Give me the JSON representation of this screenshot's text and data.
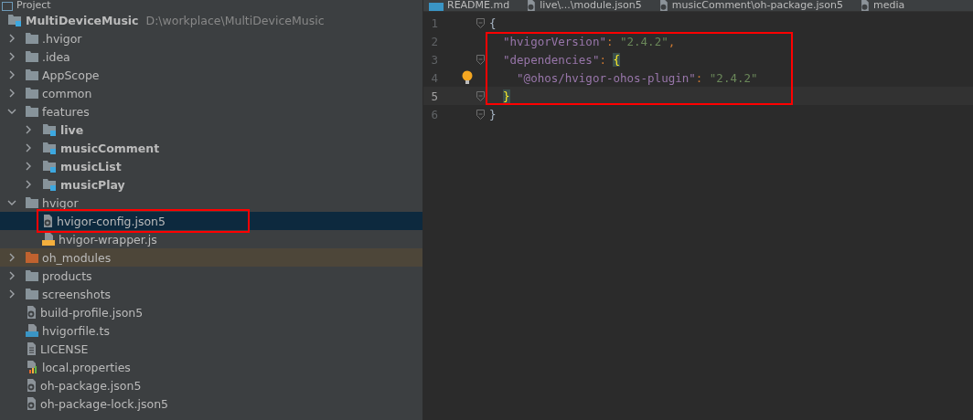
{
  "project_panel": {
    "title": "Project",
    "root": {
      "name": "MultiDeviceMusic",
      "path": "D:\\workplace\\MultiDeviceMusic"
    },
    "items": [
      {
        "name": ".hvigor",
        "kind": "folder",
        "expanded": false,
        "selected": false,
        "annotated": false
      },
      {
        "name": ".idea",
        "kind": "folder",
        "expanded": false,
        "selected": false,
        "annotated": false
      },
      {
        "name": "AppScope",
        "kind": "folder",
        "expanded": false,
        "selected": false,
        "annotated": false
      },
      {
        "name": "common",
        "kind": "folder",
        "expanded": false,
        "selected": false,
        "annotated": false
      },
      {
        "name": "features",
        "kind": "folder",
        "expanded": true,
        "selected": false,
        "annotated": false,
        "children": [
          {
            "name": "live",
            "kind": "module",
            "expanded": false,
            "selected": false,
            "annotated": false
          },
          {
            "name": "musicComment",
            "kind": "module",
            "expanded": false,
            "selected": false,
            "annotated": false
          },
          {
            "name": "musicList",
            "kind": "module",
            "expanded": false,
            "selected": false,
            "annotated": false
          },
          {
            "name": "musicPlay",
            "kind": "module",
            "expanded": false,
            "selected": false,
            "annotated": false
          }
        ]
      },
      {
        "name": "hvigor",
        "kind": "folder",
        "expanded": true,
        "selected": false,
        "annotated": false,
        "children": [
          {
            "name": "hvigor-config.json5",
            "kind": "json",
            "selected": true,
            "annotated": true
          },
          {
            "name": "hvigor-wrapper.js",
            "kind": "js",
            "selected": false,
            "annotated": false
          }
        ]
      },
      {
        "name": "oh_modules",
        "kind": "excluded",
        "expanded": false,
        "selected": false,
        "annotated": false
      },
      {
        "name": "products",
        "kind": "folder",
        "expanded": false,
        "selected": false,
        "annotated": false
      },
      {
        "name": "screenshots",
        "kind": "folder",
        "expanded": false,
        "selected": false,
        "annotated": false
      },
      {
        "name": "build-profile.json5",
        "kind": "json",
        "selected": false,
        "annotated": false
      },
      {
        "name": "hvigorfile.ts",
        "kind": "ts",
        "selected": false,
        "annotated": false
      },
      {
        "name": "LICENSE",
        "kind": "text",
        "selected": false,
        "annotated": false
      },
      {
        "name": "local.properties",
        "kind": "properties",
        "selected": false,
        "annotated": false
      },
      {
        "name": "oh-package.json5",
        "kind": "json",
        "selected": false,
        "annotated": false
      },
      {
        "name": "oh-package-lock.json5",
        "kind": "json",
        "selected": false,
        "annotated": false
      }
    ]
  },
  "editor_tabs": [
    {
      "label": "README.md",
      "kind": "md",
      "selected": false
    },
    {
      "label": "live\\...\\module.json5",
      "kind": "json",
      "selected": false
    },
    {
      "label": "musicComment\\oh-package.json5",
      "kind": "json",
      "selected": false
    },
    {
      "label": "media",
      "kind": "json",
      "selected": false
    }
  ],
  "editor": {
    "lines": [
      {
        "number": "1",
        "foldable": true,
        "current": false,
        "annotated": false,
        "tokens": [
          {
            "text": "{",
            "kind": "brace-open",
            "matched": false
          }
        ]
      },
      {
        "number": "2",
        "current": false,
        "annotated": true,
        "tokens": [
          {
            "text": "\"hvigorVersion\"",
            "kind": "key"
          },
          {
            "text": ": ",
            "kind": "punct"
          },
          {
            "text": "\"2.4.2\"",
            "kind": "string"
          },
          {
            "text": ",",
            "kind": "punct"
          }
        ]
      },
      {
        "number": "3",
        "foldable": true,
        "current": false,
        "annotated": true,
        "tokens": [
          {
            "text": "\"dependencies\"",
            "kind": "key"
          },
          {
            "text": ": ",
            "kind": "punct"
          },
          {
            "text": "{",
            "kind": "brace-open",
            "matched": true
          }
        ]
      },
      {
        "number": "4",
        "current": false,
        "annotated": true,
        "bulb": true,
        "tokens": [
          {
            "text": "\"@ohos/hvigor-ohos-plugin\"",
            "kind": "key"
          },
          {
            "text": ": ",
            "kind": "punct"
          },
          {
            "text": "\"2.4.2\"",
            "kind": "string"
          }
        ]
      },
      {
        "number": "5",
        "foldable": true,
        "current": true,
        "annotated": true,
        "tokens": [
          {
            "text": "}",
            "kind": "brace-close",
            "matched": true
          }
        ]
      },
      {
        "number": "6",
        "foldable": true,
        "current": false,
        "annotated": false,
        "tokens": [
          {
            "text": "}",
            "kind": "brace-close",
            "matched": false
          }
        ]
      }
    ]
  }
}
